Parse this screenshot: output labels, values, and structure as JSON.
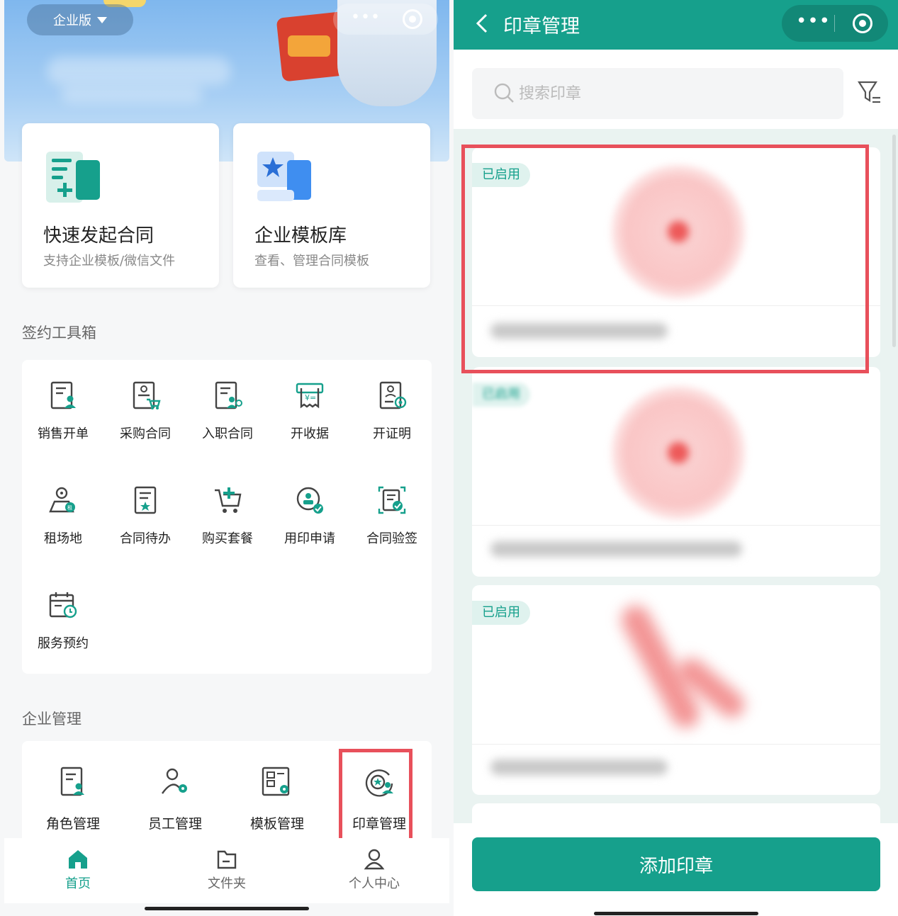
{
  "left_panel": {
    "enterprise_switch": "企业版",
    "quick_cards": [
      {
        "title": "快速发起合同",
        "subtitle": "支持企业模板/微信文件",
        "icon": "contract-plus-icon"
      },
      {
        "title": "企业模板库",
        "subtitle": "查看、管理合同模板",
        "icon": "template-star-icon"
      }
    ],
    "toolbox": {
      "title": "签约工具箱",
      "items": [
        {
          "label": "销售开单",
          "icon": "sales-order-icon"
        },
        {
          "label": "采购合同",
          "icon": "purchase-contract-icon"
        },
        {
          "label": "入职合同",
          "icon": "onboarding-contract-icon"
        },
        {
          "label": "开收据",
          "icon": "receipt-icon"
        },
        {
          "label": "开证明",
          "icon": "certificate-icon"
        },
        {
          "label": "租场地",
          "icon": "venue-rent-icon"
        },
        {
          "label": "合同待办",
          "icon": "contract-todo-icon"
        },
        {
          "label": "购买套餐",
          "icon": "buy-package-icon"
        },
        {
          "label": "用印申请",
          "icon": "seal-apply-icon"
        },
        {
          "label": "合同验签",
          "icon": "contract-verify-icon"
        },
        {
          "label": "服务预约",
          "icon": "service-booking-icon"
        }
      ]
    },
    "management": {
      "title": "企业管理",
      "items": [
        {
          "label": "角色管理",
          "icon": "role-icon"
        },
        {
          "label": "员工管理",
          "icon": "staff-icon"
        },
        {
          "label": "模板管理",
          "icon": "template-manage-icon"
        },
        {
          "label": "印章管理",
          "icon": "seal-manage-icon"
        }
      ]
    },
    "tabbar": [
      {
        "label": "首页",
        "icon": "home-icon",
        "active": true
      },
      {
        "label": "文件夹",
        "icon": "folder-icon",
        "active": false
      },
      {
        "label": "个人中心",
        "icon": "user-icon",
        "active": false
      }
    ]
  },
  "right_panel": {
    "title": "印章管理",
    "search_placeholder": "搜索印章",
    "seals": [
      {
        "status": "已启用"
      },
      {
        "status": "已启用"
      },
      {
        "status": "已启用"
      }
    ],
    "add_button": "添加印章"
  },
  "colors": {
    "primary": "#16a08c",
    "highlight": "#e8505b",
    "badge_bg": "#dff2ee"
  }
}
